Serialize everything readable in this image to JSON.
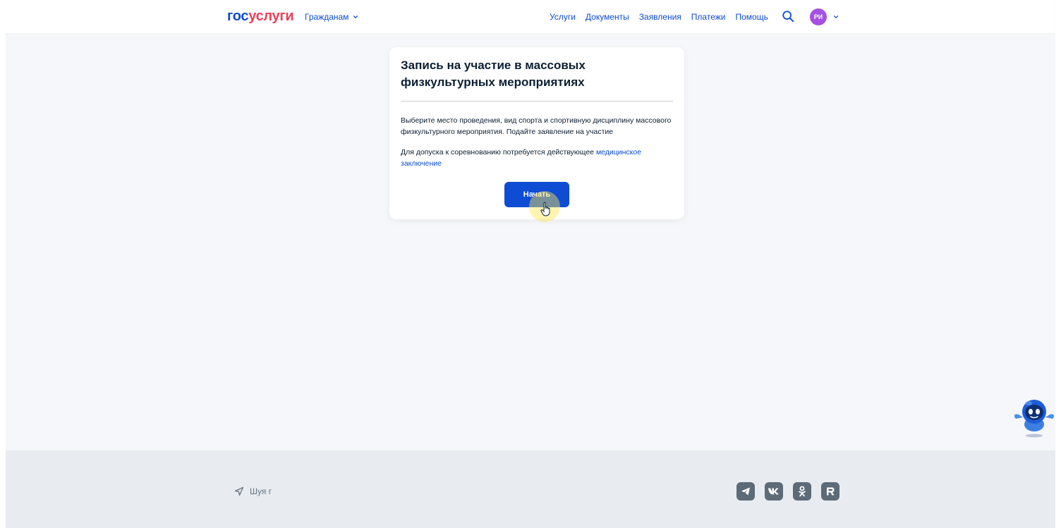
{
  "header": {
    "logo_part1": "гос",
    "logo_part2": "услуги",
    "audience": "Гражданам",
    "nav": [
      "Услуги",
      "Документы",
      "Заявления",
      "Платежи",
      "Помощь"
    ],
    "avatar_initials": "РИ"
  },
  "card": {
    "title": "Запись на участие в массовых физкультурных мероприятиях",
    "description": "Выберите место проведения, вид спорта и спортивную дисциплину массового физкультурного мероприятия. Подайте заявление на участие",
    "note_prefix": "Для допуска к соревнованию потребуется действующее ",
    "note_link": "медицинское заключение",
    "start_button": "Начать"
  },
  "footer": {
    "location": "Шуя г",
    "socials": [
      "telegram-icon",
      "vk-icon",
      "ok-icon",
      "rutube-icon"
    ]
  },
  "colors": {
    "primary": "#0d4cd3",
    "logo_accent": "#ee3f58",
    "avatar_bg": "#a64fe0",
    "page_bg": "#f5f7fa",
    "footer_bg": "#e8ecf1"
  }
}
